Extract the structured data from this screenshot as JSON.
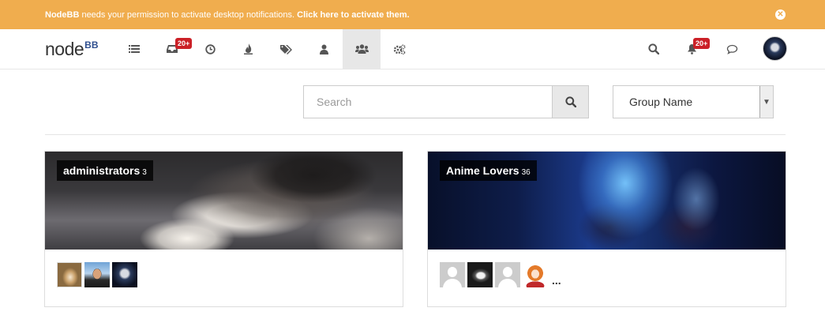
{
  "notification": {
    "brand": "NodeBB",
    "message": " needs your permission to activate desktop notifications. ",
    "action": "Click here to activate them.",
    "close_icon": "times-circle-icon"
  },
  "navbar": {
    "brand": "node",
    "brand_suffix": "BB",
    "items": [
      {
        "name": "categories",
        "icon": "list-icon"
      },
      {
        "name": "unread",
        "icon": "inbox-icon",
        "badge": "20+"
      },
      {
        "name": "recent",
        "icon": "clock-icon"
      },
      {
        "name": "popular",
        "icon": "fire-icon"
      },
      {
        "name": "tags",
        "icon": "tags-icon"
      },
      {
        "name": "users",
        "icon": "user-icon"
      },
      {
        "name": "groups",
        "icon": "users-icon",
        "active": true
      },
      {
        "name": "admin",
        "icon": "cogs-icon"
      }
    ],
    "right": {
      "search_icon": "search-icon",
      "notifications_badge": "20+",
      "chat_icon": "comment-icon"
    }
  },
  "toolbar": {
    "search_placeholder": "Search",
    "sort_value": "Group Name"
  },
  "groups": [
    {
      "name": "administrators",
      "member_count": "3",
      "members": [
        "dog-avatar",
        "man-avatar",
        "dark-avatar"
      ],
      "more": ""
    },
    {
      "name": "Anime Lovers",
      "member_count": "36",
      "members": [
        "default-avatar",
        "cat-avatar",
        "default-avatar",
        "anime-girl-avatar"
      ],
      "more": "..."
    }
  ]
}
